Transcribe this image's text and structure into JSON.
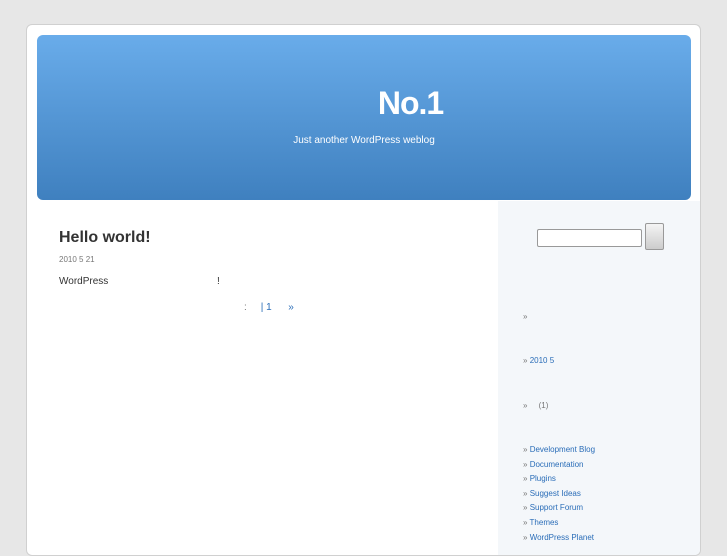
{
  "header": {
    "title": "No.1",
    "description": "Just another WordPress weblog"
  },
  "post": {
    "title": "Hello world!",
    "date": "2010 5 21",
    "body": "WordPress",
    "body_end": "!",
    "meta_colon": ":",
    "comments": "| 1",
    "more": "»"
  },
  "sidebar": {
    "bullet": "»",
    "archive": "2010 5",
    "category_count": "(1)",
    "links": [
      "Development Blog",
      "Documentation",
      "Plugins",
      "Suggest Ideas",
      "Support Forum",
      "Themes",
      "WordPress Planet"
    ]
  }
}
